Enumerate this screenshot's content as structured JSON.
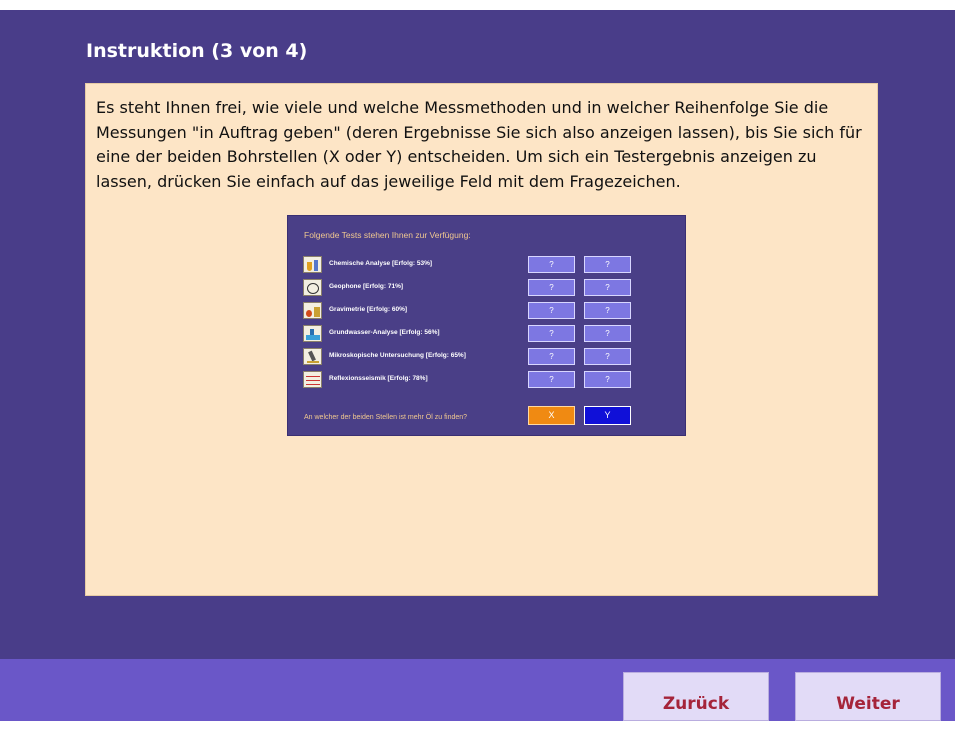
{
  "page": {
    "title": "Instruktion (3 von 4)",
    "body_text": "Es steht Ihnen frei, wie viele und welche Messmethoden und in welcher Reihenfolge Sie die Messungen \"in Auftrag geben\" (deren Ergebnisse Sie sich also anzeigen lassen), bis Sie sich für eine der beiden Bohrstellen (X oder Y) entscheiden. Um sich ein Testergebnis anzeigen zu lassen, drücken Sie einfach auf das jeweilige Feld mit dem Fragezeichen."
  },
  "example": {
    "header": "Folgende Tests stehen Ihnen zur Verfügung:",
    "tests": [
      {
        "label": "Chemische Analyse [Erfolg: 53%]",
        "icon": "chemistry-icon",
        "x": "?",
        "y": "?"
      },
      {
        "label": "Geophone [Erfolg: 71%]",
        "icon": "geophone-icon",
        "x": "?",
        "y": "?"
      },
      {
        "label": "Gravimetrie [Erfolg: 60%]",
        "icon": "gravimetry-icon",
        "x": "?",
        "y": "?"
      },
      {
        "label": "Grundwasser-Analyse [Erfolg: 56%]",
        "icon": "groundwater-icon",
        "x": "?",
        "y": "?"
      },
      {
        "label": "Mikroskopische Untersuchung [Erfolg: 65%]",
        "icon": "microscope-icon",
        "x": "?",
        "y": "?"
      },
      {
        "label": "Reflexionsseismik [Erfolg: 78%]",
        "icon": "seismic-icon",
        "x": "?",
        "y": "?"
      }
    ],
    "question": "An welcher der beiden Stellen ist mehr Öl zu finden?",
    "choice_x": "X",
    "choice_y": "Y"
  },
  "nav": {
    "back_label": "Zurück",
    "next_label": "Weiter"
  },
  "colors": {
    "background": "#493d89",
    "panel": "#fde5c6",
    "footer": "#6a57c8",
    "nav_text": "#a5243a",
    "choice_x": "#f08a12",
    "choice_y": "#1010d8"
  }
}
